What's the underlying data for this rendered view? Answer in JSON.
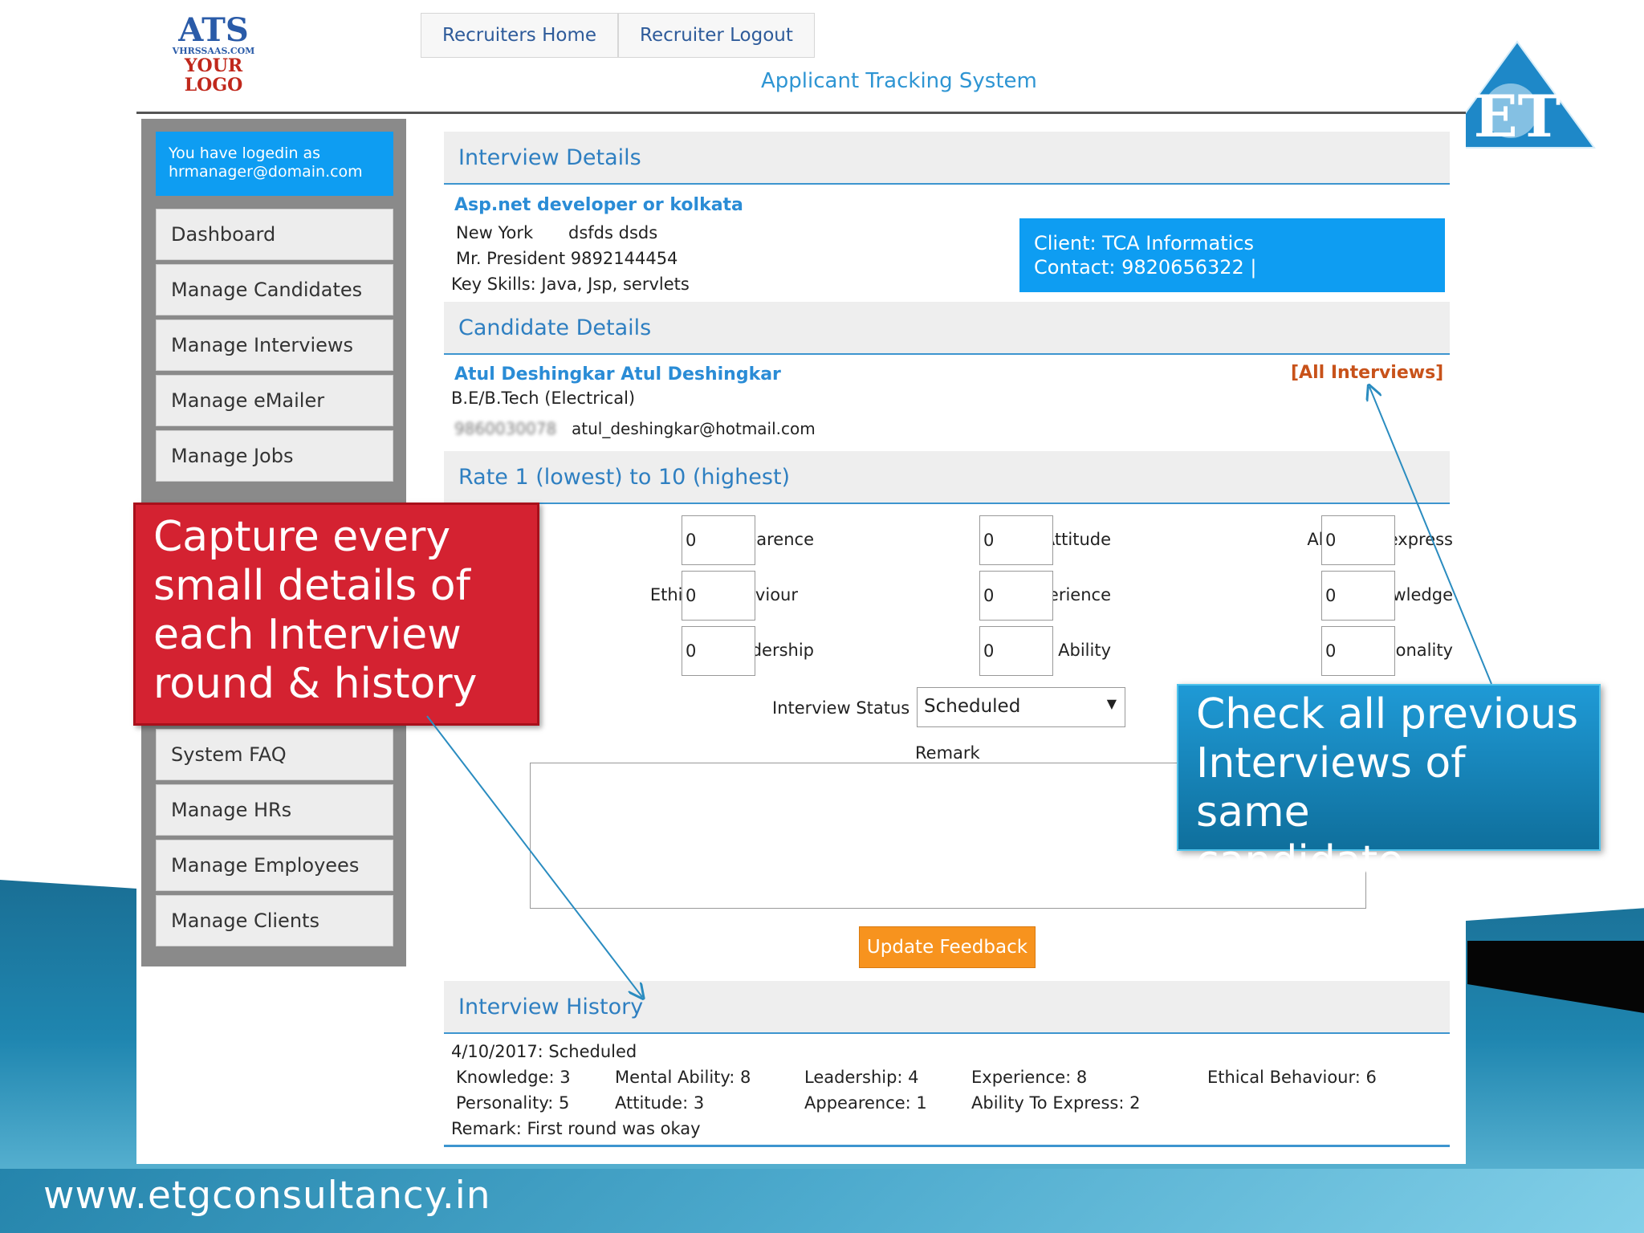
{
  "logo": {
    "line1": "ATS",
    "line2": "VHRSSAAS.COM",
    "line3": "YOUR",
    "line4": "LOGO"
  },
  "topnav": {
    "home": "Recruiters Home",
    "logout": "Recruiter Logout"
  },
  "subtitle": "Applicant Tracking System",
  "sidebar": {
    "login_line1": "You have logedin as",
    "login_line2": "hrmanager@domain.com",
    "items": [
      "Dashboard",
      "Manage Candidates",
      "Manage Interviews",
      "Manage eMailer",
      "Manage Jobs",
      "System FAQ",
      "Manage HRs",
      "Manage Employees",
      "Manage Clients"
    ]
  },
  "interview": {
    "heading": "Interview Details",
    "job_title": "Asp.net developer or kolkata",
    "city": "New York",
    "location": "dsfds dsds",
    "contact": "Mr. President 9892144454",
    "skills": "Key Skills: Java, Jsp, servlets",
    "client": "Client: TCA Informatics",
    "client_contact": "Contact: 9820656322 |"
  },
  "candidate": {
    "heading": "Candidate Details",
    "name": "Atul Deshingkar Atul Deshingkar",
    "all_interviews": "[All Interviews]",
    "qualification": "B.E/B.Tech (Electrical)",
    "phone": "9860030078",
    "email": "atul_deshingkar@hotmail.com"
  },
  "rating": {
    "heading": "Rate 1 (lowest) to 10 (highest)",
    "fields": [
      {
        "label": "Appearence",
        "value": "0"
      },
      {
        "label": "Attitude",
        "value": "0"
      },
      {
        "label": "Ability to express",
        "value": "0"
      },
      {
        "label": "Ethical Behaviour",
        "value": "0"
      },
      {
        "label": "Experience",
        "value": "0"
      },
      {
        "label": "Knowledge",
        "value": "0"
      },
      {
        "label": "Leadership",
        "value": "0"
      },
      {
        "label": "Mental Ability",
        "value": "0"
      },
      {
        "label": "Personality",
        "value": "0"
      }
    ],
    "status_label": "Interview Status",
    "status_value": "Scheduled",
    "remark_label": "Remark",
    "update_button": "Update Feedback"
  },
  "history": {
    "heading": "Interview History",
    "date_status": "4/10/2017: Scheduled",
    "knowledge": "Knowledge: 3",
    "mental": "Mental Ability: 8",
    "leadership": "Leadership: 4",
    "experience": "Experience: 8",
    "ethical": "Ethical Behaviour: 6",
    "personality": "Personality: 5",
    "attitude": "Attitude: 3",
    "appearence": "Appearence: 1",
    "ability": "Ability To Express: 2",
    "remark": "Remark: First round was okay"
  },
  "callouts": {
    "red": [
      "Capture every",
      "small details of",
      "each Interview",
      "round & history"
    ],
    "blue": [
      "Check all previous",
      "Interviews of same",
      "candidate"
    ]
  },
  "footer": "www.etgconsultancy.in",
  "et_logo_text": "ET",
  "colors": {
    "accent_blue": "#0e9df2",
    "heading_blue": "#2e7fc1",
    "orange": "#f7931e",
    "red_callout": "#d42231"
  }
}
